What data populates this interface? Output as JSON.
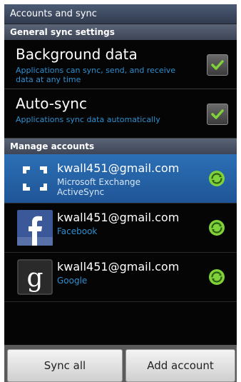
{
  "header": {
    "title": "Accounts and sync"
  },
  "general": {
    "section_label": "General sync settings",
    "settings": [
      {
        "title": "Background data",
        "subtitle": "Applications can sync, send, and receive data at any time",
        "checked": true
      },
      {
        "title": "Auto-sync",
        "subtitle": "Applications sync data automatically",
        "checked": true
      }
    ]
  },
  "manage": {
    "section_label": "Manage accounts",
    "accounts": [
      {
        "email": "kwall451@gmail.com",
        "type": "Microsoft Exchange ActiveSync",
        "icon": "exchange-icon",
        "selected": true
      },
      {
        "email": "kwall451@gmail.com",
        "type": "Facebook",
        "icon": "facebook-icon",
        "selected": false
      },
      {
        "email": "kwall451@gmail.com",
        "type": "Google",
        "icon": "google-icon",
        "selected": false
      }
    ]
  },
  "buttons": {
    "sync_all": "Sync all",
    "add_account": "Add account"
  },
  "colors": {
    "accent_blue": "#2e8fd0",
    "check_green": "#7fd23a",
    "selected_row": "#2563a8"
  }
}
